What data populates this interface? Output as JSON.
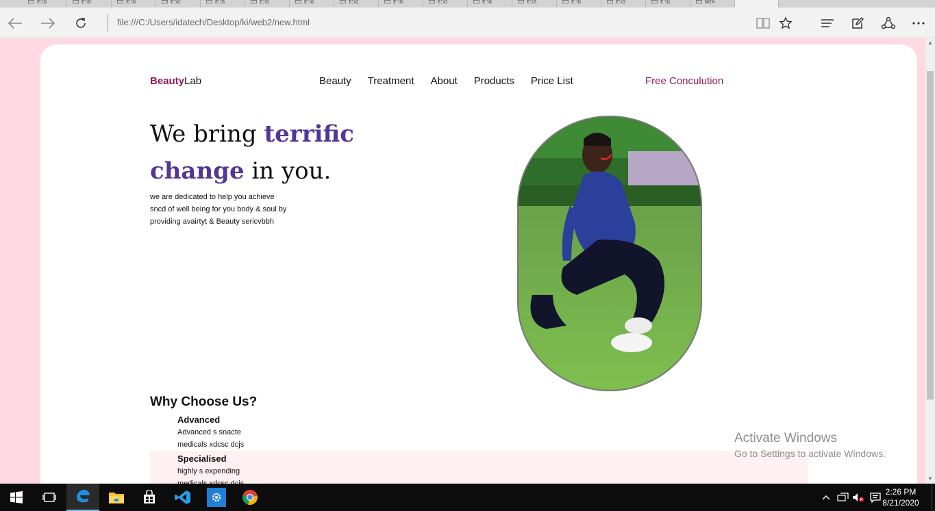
{
  "browser": {
    "tab_labels": [
      "ᴇ:\\ɢ",
      "ᴇ:\\ɢ",
      "ᴇ:\\ɢ",
      "ᴇ:\\ɢ",
      "ᴇ:\\ɢ",
      "ᴇ:\\ɢ",
      "ᴇ:\\ɢ",
      "ᴇ:\\ɢ",
      "ᴇ:\\ɢ",
      "ᴇ:\\ɢ",
      "ᴇ:\\ɢ",
      "ᴇ:\\ɢ",
      "ᴇ:\\ɢ",
      "ᴇ:\\ɢ",
      "ᴇ:\\ɢ",
      "ᴍɪɴ"
    ],
    "address": "file:///C:/Users/idatech/Desktop/ki/web2/new.html",
    "icons": [
      "back-icon",
      "forward-icon",
      "refresh-icon",
      "reading-view-icon",
      "favorites-star-icon",
      "hub-icon",
      "web-note-icon",
      "share-icon",
      "more-icon"
    ]
  },
  "site": {
    "brand_bold": "Beauty",
    "brand_rest": "Lab",
    "nav": [
      "Beauty",
      "Treatment",
      "About",
      "Products",
      "Price List"
    ],
    "cta": "Free Conculution",
    "hero": {
      "t1": "We bring ",
      "t2": "terrific",
      "t3": "change",
      "t4": " in you.",
      "desc": [
        "we are dedicated to help you achieve",
        "sncd of well being for you body & soul by",
        "providing avairtyt & Beauty sericvbbh"
      ]
    },
    "why_title": "Why Choose Us?",
    "features": [
      {
        "title": "Advanced",
        "lines": [
          "Advanced s snacte",
          "medicals xdcsc dcjs"
        ]
      },
      {
        "title": "Specialised",
        "lines": [
          "highly s expending",
          "medicals xdcsc dcjs"
        ]
      }
    ],
    "colors": {
      "brand": "#8e1a58",
      "highlight": "#533795",
      "background": "#ffd9e3"
    }
  },
  "watermark": {
    "line1": "Activate Windows",
    "line2": "Go to Settings to activate Windows."
  },
  "taskbar": {
    "apps": [
      "windows-start-icon",
      "task-view-icon",
      "edge-icon",
      "file-explorer-icon",
      "store-icon",
      "vscode-icon",
      "settings-app-icon",
      "chrome-icon"
    ],
    "time": "2:26 PM",
    "date": "8/21/2020"
  }
}
